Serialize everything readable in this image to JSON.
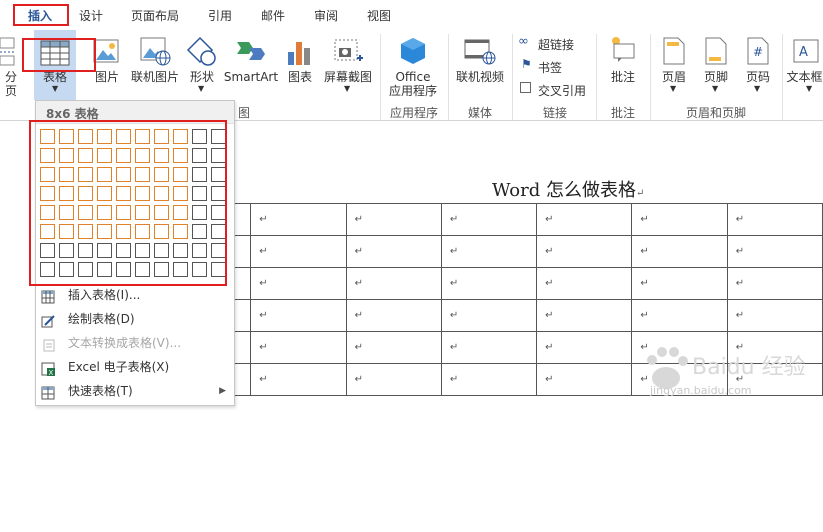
{
  "tabs": [
    "插入",
    "设计",
    "页面布局",
    "引用",
    "邮件",
    "审阅",
    "视图"
  ],
  "ribbon": {
    "left_partial": "分页",
    "buttons": {
      "table": "表格",
      "picture": "图片",
      "online_picture": "联机图片",
      "shapes": "形状",
      "smartart": "SmartArt",
      "chart": "图表",
      "screenshot": "屏幕截图",
      "office_line1": "Office",
      "office_line2": "应用程序",
      "online_video": "联机视频",
      "hyperlink": "超链接",
      "bookmark": "书签",
      "cross_ref": "交叉引用",
      "comment": "批注",
      "header": "页眉",
      "footer": "页脚",
      "page_number": "页码",
      "textbox_partial": "文本框"
    },
    "groups": {
      "illustrations_partial": "图",
      "apps": "应用程序",
      "media": "媒体",
      "links": "链接",
      "comments": "批注",
      "header_footer": "页眉和页脚"
    }
  },
  "dropdown": {
    "header": "8x6 表格",
    "grid": {
      "columns": 10,
      "rows": 8,
      "selected_columns": 8,
      "selected_rows": 6
    },
    "items": [
      {
        "label": "插入表格(I)...",
        "icon": "table-grid-icon",
        "disabled": false
      },
      {
        "label": "绘制表格(D)",
        "icon": "pencil-table-icon",
        "disabled": false
      },
      {
        "label": "文本转换成表格(V)...",
        "icon": "text-to-table-icon",
        "disabled": true
      },
      {
        "label": "Excel 电子表格(X)",
        "icon": "excel-icon",
        "disabled": false
      },
      {
        "label": "快速表格(T)",
        "icon": "quick-table-icon",
        "disabled": false
      }
    ]
  },
  "document": {
    "title": "Word 怎么做表格",
    "paragraph_mark": "↵",
    "table": {
      "rows": 6,
      "columns": 7
    }
  },
  "watermark": {
    "brand": "Baidu 经验",
    "url": "jingyan.baidu.com"
  },
  "colors": {
    "accent": "#2b579a",
    "highlight_border": "#e02020",
    "grid_selected": "#e0822c",
    "table_button_bg": "#c5d9f1"
  }
}
